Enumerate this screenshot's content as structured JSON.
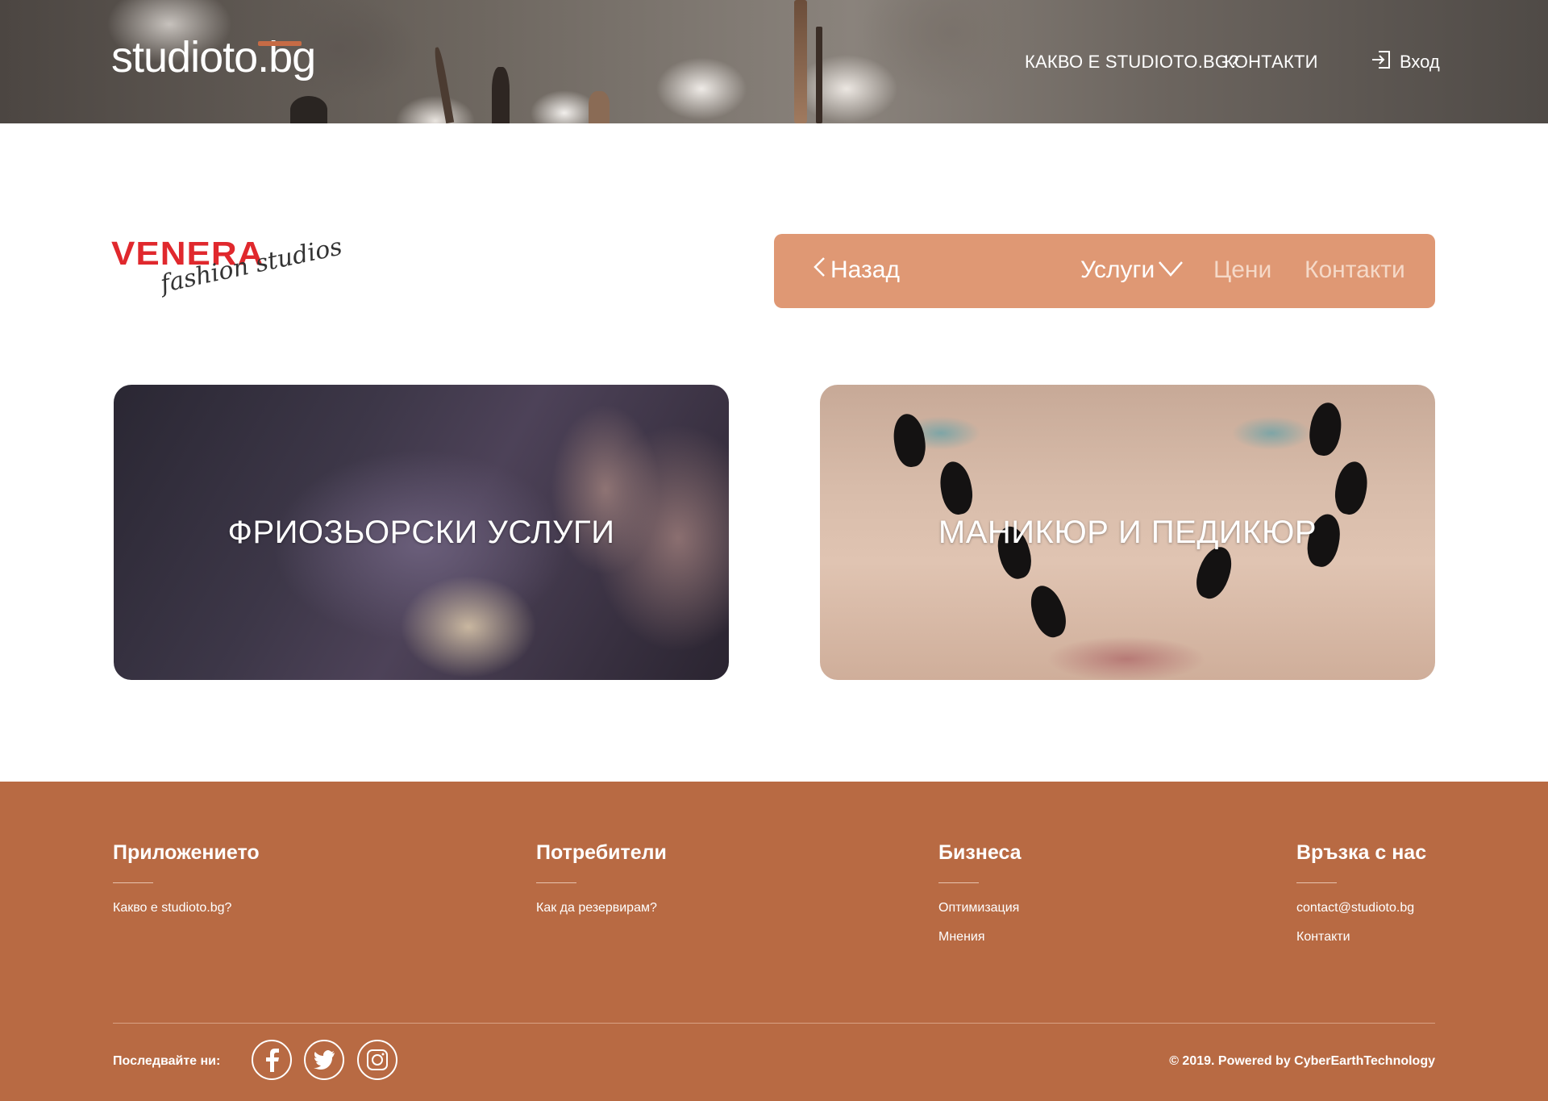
{
  "header": {
    "logo": "studioto.bg",
    "nav": [
      "КАКВО Е STUDIOTO.BG?",
      "КОНТАКТИ"
    ],
    "login_label": "Вход",
    "icons": {
      "login": "login-icon"
    }
  },
  "salon": {
    "logo_primary": "VENERA",
    "logo_secondary": "fashion studios",
    "nav": {
      "back": "Назад",
      "services": "Услуги",
      "prices": "Цени",
      "contacts": "Контакти"
    },
    "colors": {
      "nav_bg": "#df9874",
      "logo_red": "#e0282d"
    }
  },
  "cards": [
    {
      "title": "ФРИОЗЬОРСКИ УСЛУГИ"
    },
    {
      "title": "МАНИКЮР И ПЕДИКЮР"
    }
  ],
  "footer": {
    "columns": [
      {
        "title": "Приложението",
        "links": [
          "Какво е studioto.bg?"
        ]
      },
      {
        "title": "Потребители",
        "links": [
          "Как да резервирам?"
        ]
      },
      {
        "title": "Бизнеса",
        "links": [
          "Оптимизация",
          "Мнения"
        ]
      },
      {
        "title": "Връзка с нас",
        "links": [
          "contact@studioto.bg",
          "Контакти"
        ]
      }
    ],
    "follow_label": "Последвайте ни:",
    "social_icons": [
      "facebook-icon",
      "twitter-icon",
      "instagram-icon"
    ],
    "copyright": "© 2019. Powered by CyberEarthTechnology",
    "colors": {
      "background": "#b86a43"
    }
  }
}
